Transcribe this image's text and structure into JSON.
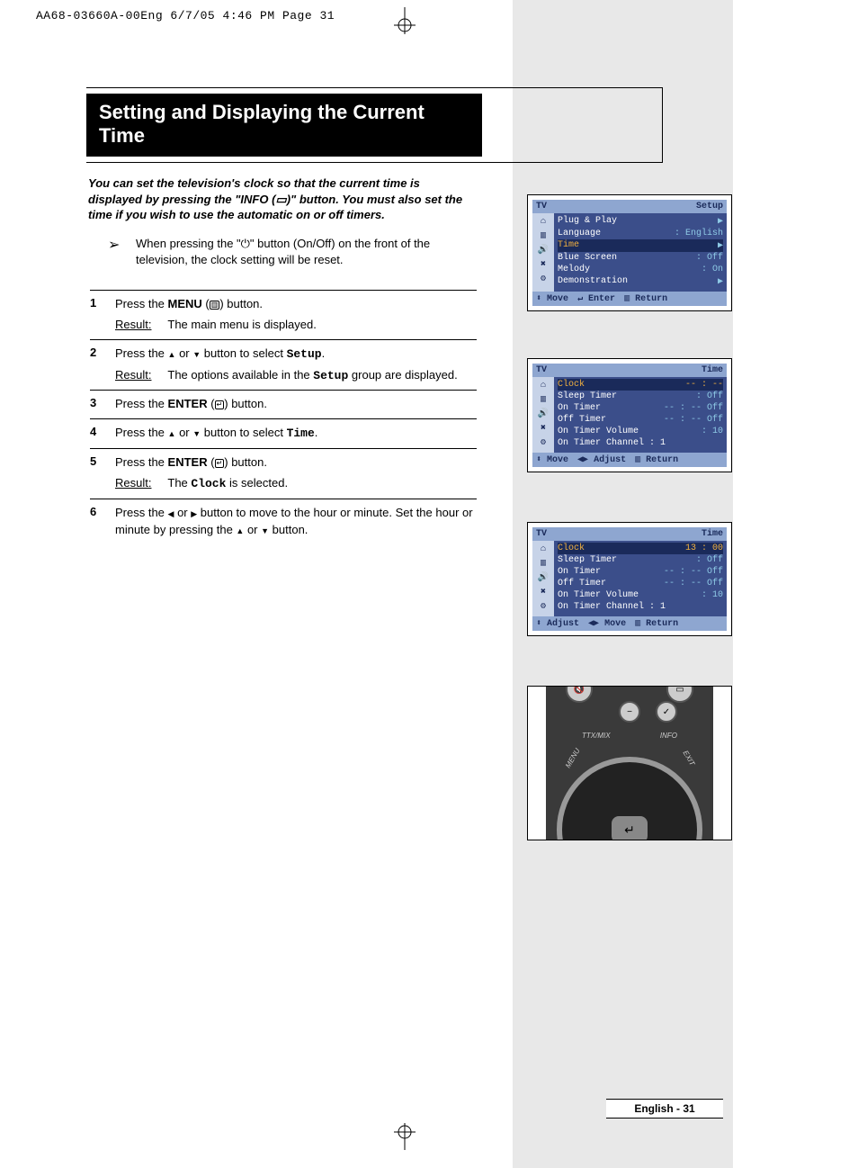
{
  "header": "AA68-03660A-00Eng  6/7/05  4:46 PM  Page 31",
  "title": "Setting and Displaying the Current Time",
  "intro": "You can set the television's clock so that the current time is displayed by pressing the \"INFO (▭)\" button. You must also set the time if you wish to use the automatic on or off timers.",
  "note": "When pressing the \"⏻\" button (On/Off) on the front of the television, the clock setting will be reset.",
  "steps": [
    {
      "n": "1",
      "text": "Press the <b>MENU</b> (<span class='icon-sm'>▥</span>) button.",
      "result": "The main menu is displayed."
    },
    {
      "n": "2",
      "text": "Press the <span class='tri'>▲</span> or <span class='tri'>▼</span> button to select <span class='mono'>Setup</span>.",
      "result": "The options available in the <span class='mono'>Setup</span> group are displayed."
    },
    {
      "n": "3",
      "text": "Press the <b>ENTER</b> (<span class='icon-sm'>↵</span>) button."
    },
    {
      "n": "4",
      "text": "Press the <span class='tri'>▲</span> or <span class='tri'>▼</span> button to select <span class='mono'>Time</span>."
    },
    {
      "n": "5",
      "text": "Press the <b>ENTER</b> (<span class='icon-sm'>↵</span>) button.",
      "result": "The <span class='mono'>Clock</span> is selected."
    },
    {
      "n": "6",
      "text": "Press the <span class='tri'>◀</span> or <span class='tri'>▶</span> button to move to the hour or minute. Set the hour or minute by pressing the <span class='tri'>▲</span> or <span class='tri'>▼</span> button."
    }
  ],
  "result_label": "Result:",
  "osd1": {
    "tv": "TV",
    "title": "Setup",
    "rows": [
      {
        "l": "Plug & Play",
        "a": "▶"
      },
      {
        "l": "Language",
        "v": ": English"
      },
      {
        "l": "Time",
        "a": "▶",
        "hl": true
      },
      {
        "l": "Blue Screen",
        "v": ": Off"
      },
      {
        "l": "Melody",
        "v": ": On"
      },
      {
        "l": "Demonstration",
        "a": "▶"
      }
    ],
    "foot": [
      "⬍ Move",
      "↵ Enter",
      "▥ Return"
    ]
  },
  "osd2": {
    "tv": "TV",
    "title": "Time",
    "rows": [
      {
        "l": "Clock",
        "v": "-- : --",
        "hl": true
      },
      {
        "l": "Sleep Timer",
        "v": ": Off"
      },
      {
        "l": "On Timer",
        "v": "-- : -- Off"
      },
      {
        "l": "Off Timer",
        "v": "-- : -- Off"
      },
      {
        "l": "On Timer Volume",
        "v": ": 10"
      },
      {
        "l": "On Timer Channel : 1",
        "v": ""
      }
    ],
    "foot": [
      "⬍ Move",
      "◀▶ Adjust",
      "▥ Return"
    ]
  },
  "osd3": {
    "tv": "TV",
    "title": "Time",
    "rows": [
      {
        "l": "Clock",
        "v": "13 : 00",
        "hl": true
      },
      {
        "l": "Sleep Timer",
        "v": ": Off"
      },
      {
        "l": "On Timer",
        "v": "-- : -- Off"
      },
      {
        "l": "Off Timer",
        "v": "-- : -- Off"
      },
      {
        "l": "On Timer Volume",
        "v": ": 10"
      },
      {
        "l": "On Timer Channel : 1",
        "v": ""
      }
    ],
    "foot": [
      "⬍ Adjust",
      "◀▶ Move",
      "▥ Return"
    ]
  },
  "remote_labels": {
    "ttx": "TTX/MIX",
    "info": "INFO",
    "menu": "MENU",
    "exit": "EXIT"
  },
  "footer": "English - 31"
}
